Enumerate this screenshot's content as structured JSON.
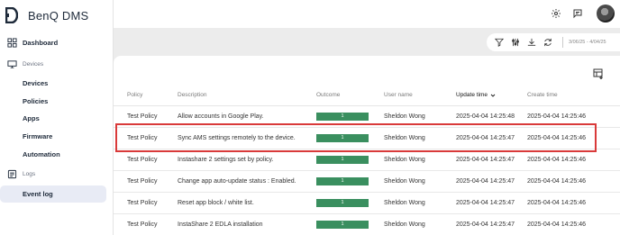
{
  "app": {
    "brand": "BenQ DMS"
  },
  "topbar": {
    "icons": [
      "settings-icon",
      "message-icon",
      "user-avatar"
    ]
  },
  "sidebar": {
    "dashboard": "Dashboard",
    "devices_section": "Devices",
    "devices": "Devices",
    "policies": "Policies",
    "apps": "Apps",
    "firmware": "Firmware",
    "automation": "Automation",
    "logs_section": "Logs",
    "event_log": "Event log"
  },
  "toolbar": {
    "date_range": "3/06/25 - 4/04/25"
  },
  "table": {
    "headers": {
      "policy": "Policy",
      "description": "Description",
      "outcome": "Outcome",
      "user": "User name",
      "updated": "Update time",
      "created": "Create time"
    },
    "rows": [
      {
        "policy": "Test Policy",
        "description": "Allow accounts in Google Play.",
        "outcome": "1",
        "user": "Sheldon Wong",
        "updated": "2025-04-04 14:25:48",
        "created": "2025-04-04 14:25:46"
      },
      {
        "policy": "Test Policy",
        "description": "Sync AMS settings remotely to the device.",
        "outcome": "1",
        "user": "Sheldon Wong",
        "updated": "2025-04-04 14:25:47",
        "created": "2025-04-04 14:25:46"
      },
      {
        "policy": "Test Policy",
        "description": "Instashare 2 settings set by policy.",
        "outcome": "1",
        "user": "Sheldon Wong",
        "updated": "2025-04-04 14:25:47",
        "created": "2025-04-04 14:25:46"
      },
      {
        "policy": "Test Policy",
        "description": "Change app auto-update status : Enabled.",
        "outcome": "1",
        "user": "Sheldon Wong",
        "updated": "2025-04-04 14:25:47",
        "created": "2025-04-04 14:25:46"
      },
      {
        "policy": "Test Policy",
        "description": "Reset app block / white list.",
        "outcome": "1",
        "user": "Sheldon Wong",
        "updated": "2025-04-04 14:25:47",
        "created": "2025-04-04 14:25:46"
      },
      {
        "policy": "Test Policy",
        "description": "InstaShare 2 EDLA installation",
        "outcome": "1",
        "user": "Sheldon Wong",
        "updated": "2025-04-04 14:25:47",
        "created": "2025-04-04 14:25:46"
      }
    ]
  },
  "colors": {
    "outcome_success": "#3a8f5f",
    "highlight": "#d93a3a",
    "active_nav": "#e8ebf5"
  }
}
